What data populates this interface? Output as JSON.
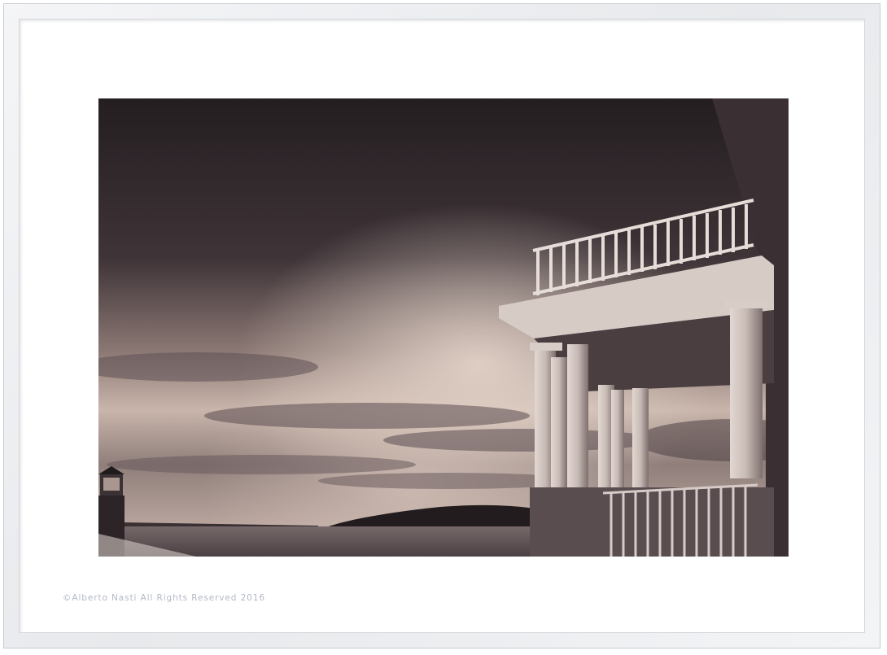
{
  "photo": {
    "subject": "lighthouse-keeper-house-porch-storm-sky",
    "tone_color": "#3a2f33"
  },
  "caption": {
    "copyright": "©Alberto Nasti All Rights Reserved 2016"
  },
  "colors": {
    "frame": "#e9ebee",
    "mat": "#ffffff",
    "caption_text": "#b3b8c6"
  }
}
